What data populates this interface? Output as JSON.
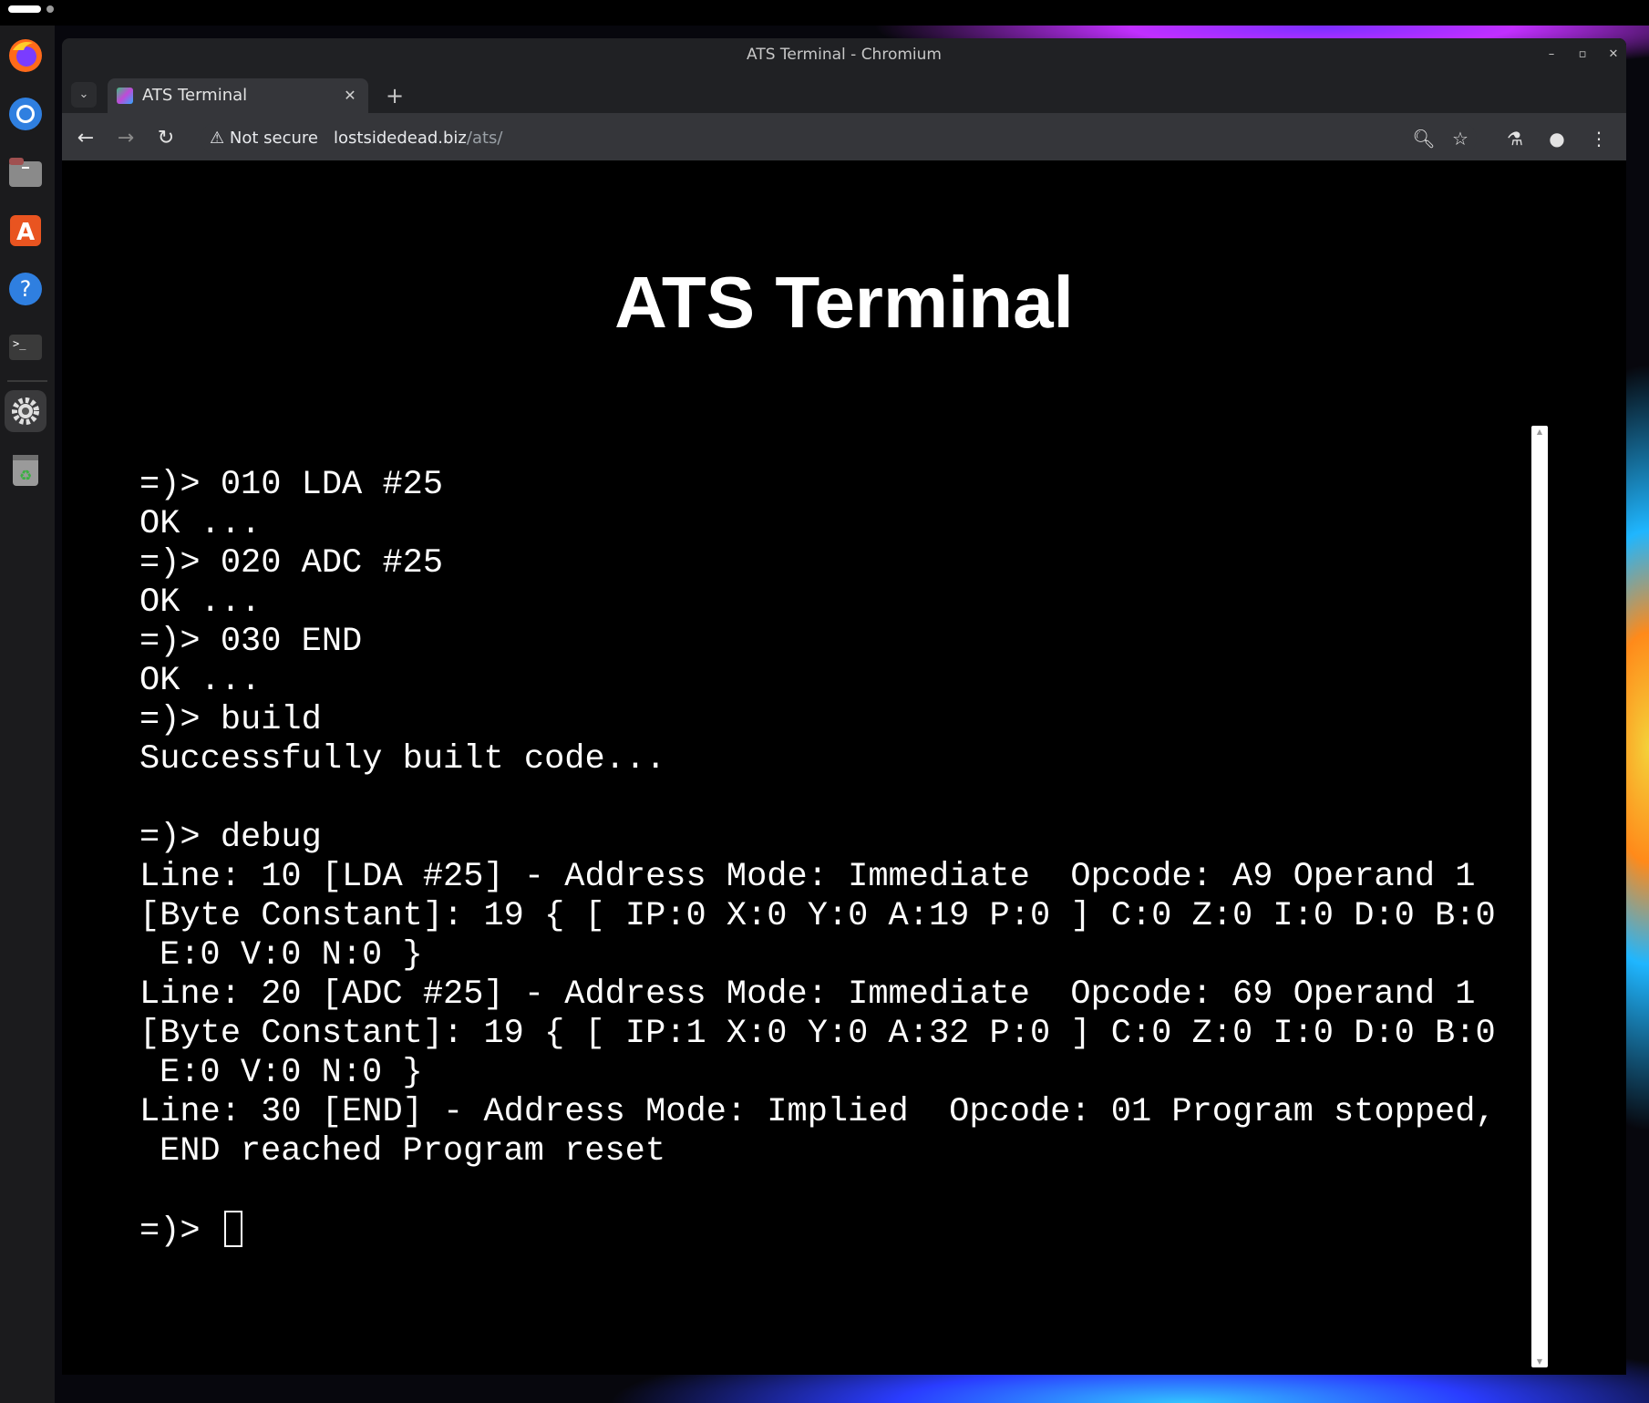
{
  "browser": {
    "window_title": "ATS Terminal - Chromium",
    "tab_title": "ATS Terminal",
    "security_label": "Not secure",
    "url_host": "lostsidedead.biz",
    "url_path": "/ats/"
  },
  "page": {
    "title": "ATS Terminal"
  },
  "terminal": {
    "lines": [
      "=)> 010 LDA #25",
      "OK ...",
      "=)> 020 ADC #25",
      "OK ...",
      "=)> 030 END",
      "OK ...",
      "=)> build",
      "Successfully built code...",
      "",
      "=)> debug",
      "Line: 10 [LDA #25] - Address Mode: Immediate  Opcode: A9 Operand 1",
      "[Byte Constant]: 19 { [ IP:0 X:0 Y:0 A:19 P:0 ] C:0 Z:0 I:0 D:0 B:0",
      "E:0 V:0 N:0 }",
      "Line: 20 [ADC #25] - Address Mode: Immediate  Opcode: 69 Operand 1",
      "[Byte Constant]: 19 { [ IP:1 X:0 Y:0 A:32 P:0 ] C:0 Z:0 I:0 D:0 B:0",
      "E:0 V:0 N:0 }",
      "Line: 30 [END] - Address Mode: Implied  Opcode: 01 Program stopped,",
      "END reached Program reset",
      ""
    ],
    "prompt": "=)> "
  },
  "icons": {
    "dock": [
      "firefox-icon",
      "chromium-icon",
      "files-icon",
      "app-center-icon",
      "help-icon",
      "terminal-icon",
      "settings-icon",
      "trash-icon"
    ]
  }
}
